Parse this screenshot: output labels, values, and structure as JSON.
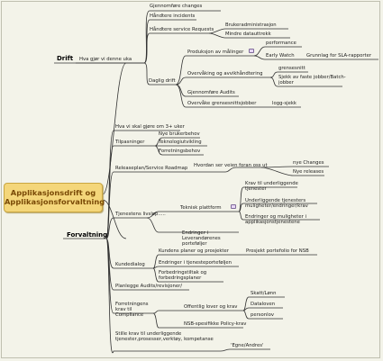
{
  "root": {
    "line1": "Applikasjonsdrift og",
    "line2": "Applikasjonsforvaltning"
  },
  "drift": {
    "title": "Drift",
    "sub": "Hva gjør vi denne uka",
    "items": {
      "gjennomfore": "Gjennomføre changes",
      "handtere_incidents": "Håndtere incidents",
      "service_requests": "Håndtere service Requests",
      "brukeradmin": "Brukeradministrasjon",
      "mindre_uttrekk": "Mindre datauttrekk",
      "daglig": "Daglig drift",
      "produksjon": "Produksjon av målinger",
      "performance": "performance",
      "early_watch": "Early Watch",
      "grunnlag": "Grunnlag for SLA-rapporter",
      "overvaking": "Overvåking og avvikhåndtering",
      "grensesnitt": "grensesnitt",
      "sjekk": "Sjekk av faste jobber/Batch-jobber",
      "audits": "Gjennomføre Audits",
      "overvake_gj": "Overvåke grensesnittsjobber",
      "logg": "logg-sjekk"
    }
  },
  "forvaltning": {
    "title": "Forvaltning",
    "sub": "Hva vi skal gjøre om 3+ uker",
    "tilpasninger": "Tilpasninger",
    "nye_behov": "Nye brukerbehov",
    "teknologi": "Teknologiutvikling",
    "forretningsbehov": "Forretningsbehov",
    "releaseplan": "Releaseplan/Service Roadmap",
    "hvordan": "Hvordan ser veien foran oss ut",
    "nye_changes": "nye Changes",
    "nye_releases": "Nye releases",
    "livslop": "Tjenestens livsløp.....",
    "teknisk": "Teknisk plattform",
    "krav_tjenester": "Krav til underliggende tjenester",
    "underliggende": "Underliggende tjenesters muligheter/endringer/krav",
    "endringer_mul": "Endringer og muligheter i applikasjonstjenestene",
    "leverandor": "Endringer i Leverandørenes porteføljer",
    "kundedialog": "Kundedialog",
    "kundens_planer": "Kundens planer og prosjekter",
    "prosjektportefolje": "Prosjekt portefolio for NSB",
    "endringer_tj": "Endringer i tjenesteporteføljen",
    "forbedring": "Forbedringstiltak og forbedringsplaner",
    "planlegge": "Planlegge Audits/revisjoner/",
    "forretningskrav": "Forretningens krav til Compliance",
    "offentlig": "Offentlig lover og krav",
    "skatt": "Skatt/Lønn",
    "dataloven": "Dataloven",
    "personlov": "personlov",
    "nsb_krav": "NSB-spesifikke Policy-krav",
    "stille_krav": "Stille krav til underliggende tjenester,prosesser,verktøy, kompetanse",
    "egne": "'Egne/Andres'"
  }
}
